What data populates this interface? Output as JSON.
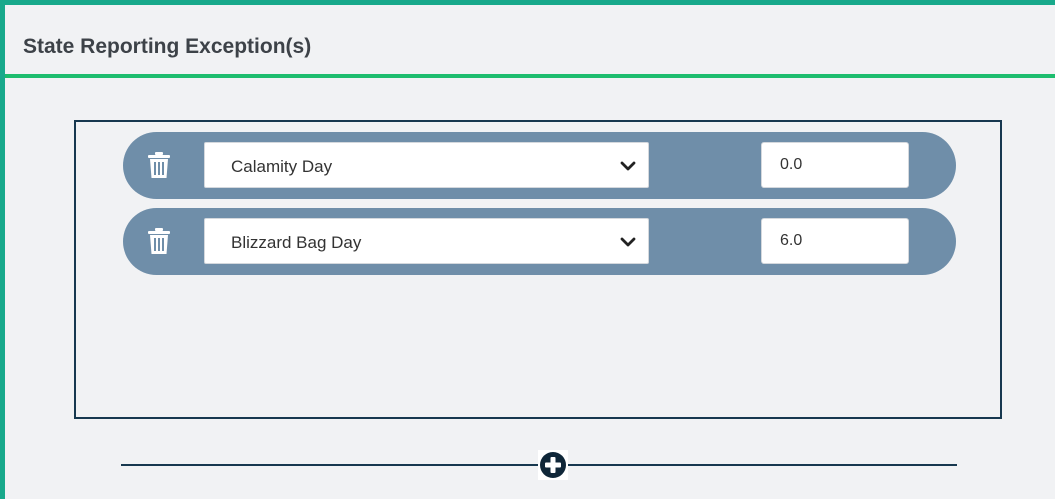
{
  "panel": {
    "title": "State Reporting Exception(s)",
    "accent_color": "#18a98b",
    "header_rule_color": "#1dbd6e"
  },
  "exceptions": [
    {
      "type": "Calamity Day",
      "value": "0.0",
      "delete_icon": "trash-icon",
      "dropdown_icon": "chevron-down-icon"
    },
    {
      "type": "Blizzard Bag Day",
      "value": "6.0",
      "delete_icon": "trash-icon",
      "dropdown_icon": "chevron-down-icon"
    }
  ],
  "row_color": "#6f8ea9",
  "add_icon": "plus-circle-icon"
}
